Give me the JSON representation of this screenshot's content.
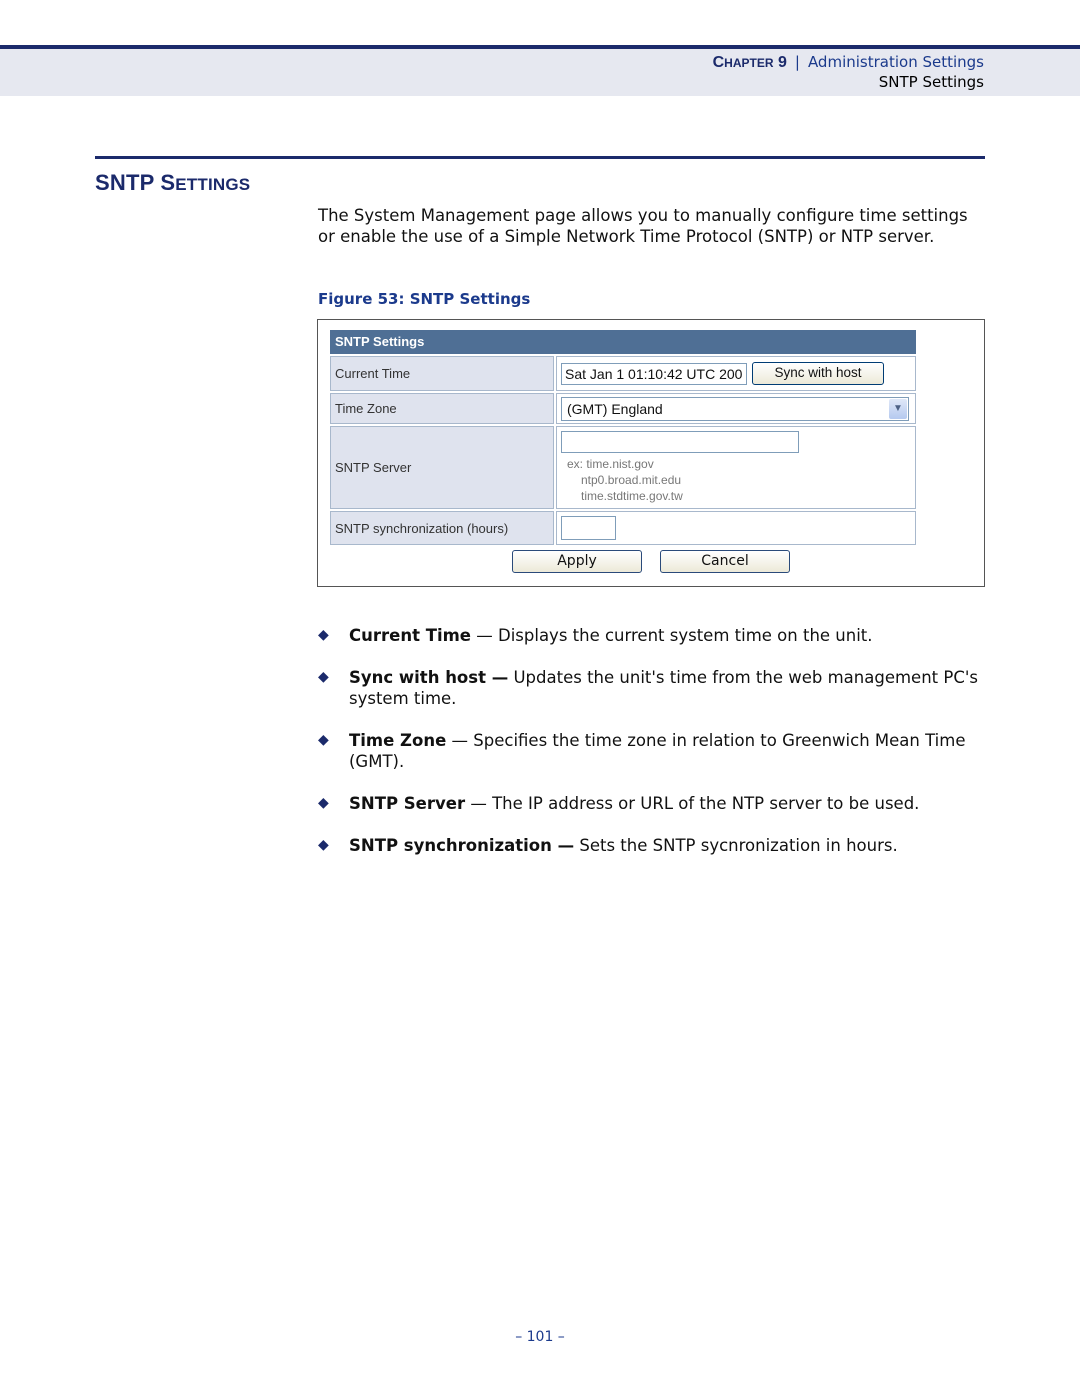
{
  "header": {
    "chapter_word": "Chapter",
    "chapter_number": "9",
    "separator": "|",
    "chapter_title": "Administration Settings",
    "section": "SNTP Settings"
  },
  "section": {
    "title_first": "SNTP S",
    "title_rest": "ETTINGS",
    "intro": "The System Management page allows you to manually configure time settings or enable the use of a Simple Network Time Protocol (SNTP) or NTP server.",
    "figure_caption": "Figure 53:  SNTP Settings"
  },
  "figure": {
    "panel_title": "SNTP Settings",
    "rows": {
      "current_time": {
        "label": "Current Time",
        "value": "Sat Jan  1 01:10:42 UTC 200",
        "button": "Sync with host"
      },
      "time_zone": {
        "label": "Time Zone",
        "selected": "(GMT) England"
      },
      "sntp_server": {
        "label": "SNTP Server",
        "value": "",
        "hints": [
          "ex: time.nist.gov",
          "ntp0.broad.mit.edu",
          "time.stdtime.gov.tw"
        ]
      },
      "sntp_sync": {
        "label": "SNTP synchronization (hours)",
        "value": ""
      }
    },
    "apply_label": "Apply",
    "cancel_label": "Cancel"
  },
  "bullets": [
    {
      "term": "Current Time",
      "dash": " — ",
      "text": "Displays the current system time on the unit."
    },
    {
      "term": "Sync with host —",
      "dash": " ",
      "text": "Updates the unit's time from the web management PC's system time."
    },
    {
      "term": "Time Zone",
      "dash": " — ",
      "text": "Specifies the time zone in relation to Greenwich Mean Time (GMT)."
    },
    {
      "term": "SNTP Server",
      "dash": " — ",
      "text": "The IP address or URL of the NTP server to be used."
    },
    {
      "term": "SNTP synchronization —",
      "dash": " ",
      "text": "Sets the SNTP sycnronization in hours."
    }
  ],
  "footer": {
    "page_number": "–  101  –"
  },
  "colors": {
    "brand_navy": "#1b2a6b",
    "link_blue": "#1b3a8c",
    "panel_header": "#4f6f95",
    "label_bg": "#dfe3ee"
  }
}
